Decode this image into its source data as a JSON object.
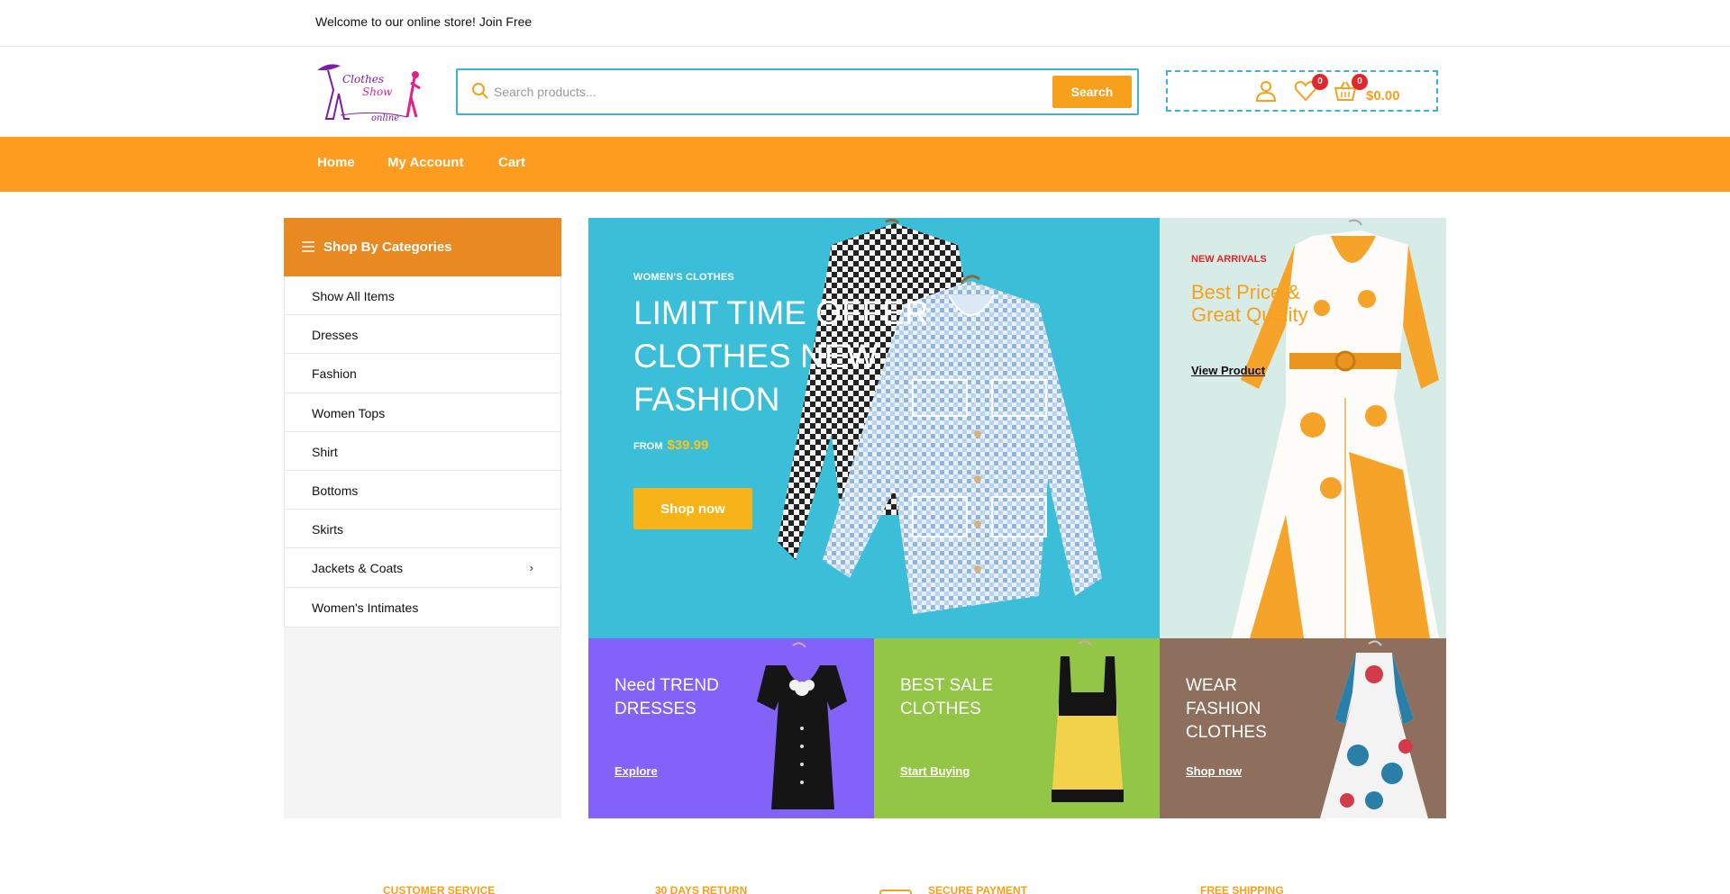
{
  "topbar": {
    "message": "Welcome to our online store! Join Free"
  },
  "header": {
    "logo_text": [
      "Clothes",
      "Show",
      "online"
    ],
    "search": {
      "placeholder": "Search products...",
      "button": "Search"
    },
    "wishlist_count": "0",
    "cart_count": "0",
    "cart_total": "$0.00"
  },
  "nav": {
    "items": [
      "Home",
      "My Account",
      "Cart"
    ]
  },
  "sidebar": {
    "title": "Shop By Categories",
    "categories": [
      "Show All Items",
      "Dresses",
      "Fashion",
      "Women Tops",
      "Shirt",
      "Bottoms",
      "Skirts",
      "Jackets & Coats",
      "Women's Intimates"
    ]
  },
  "hero": {
    "eyebrow": "WOMEN'S CLOTHES",
    "headline": "LIMIT TIME OFFER CLOTHES NEW FASHION",
    "from_label": "FROM",
    "price": "$39.99",
    "cta": "Shop now"
  },
  "promo": {
    "tag": "NEW ARRIVALS",
    "title": "Best Price & Great Quality",
    "link": "View Product"
  },
  "tiles": [
    {
      "title": "Need TREND DRESSES",
      "link": "Explore"
    },
    {
      "title": "BEST SALE CLOTHES",
      "link": "Start Buying"
    },
    {
      "title": "WEAR FASHION CLOTHES",
      "link": "Shop now"
    }
  ],
  "services": [
    "CUSTOMER SERVICE",
    "30 DAYS RETURN",
    "SECURE PAYMENT",
    "FREE SHIPPING"
  ],
  "colors": {
    "accent": "#fe9c20",
    "hero_bg": "#3bbfd8",
    "search_border": "#3bb5cf",
    "badge": "#e3262b",
    "price_yellow": "#f7c51b"
  },
  "icons": [
    "search-icon",
    "user-icon",
    "heart-icon",
    "basket-icon",
    "menu-icon",
    "chevron-right-icon"
  ]
}
